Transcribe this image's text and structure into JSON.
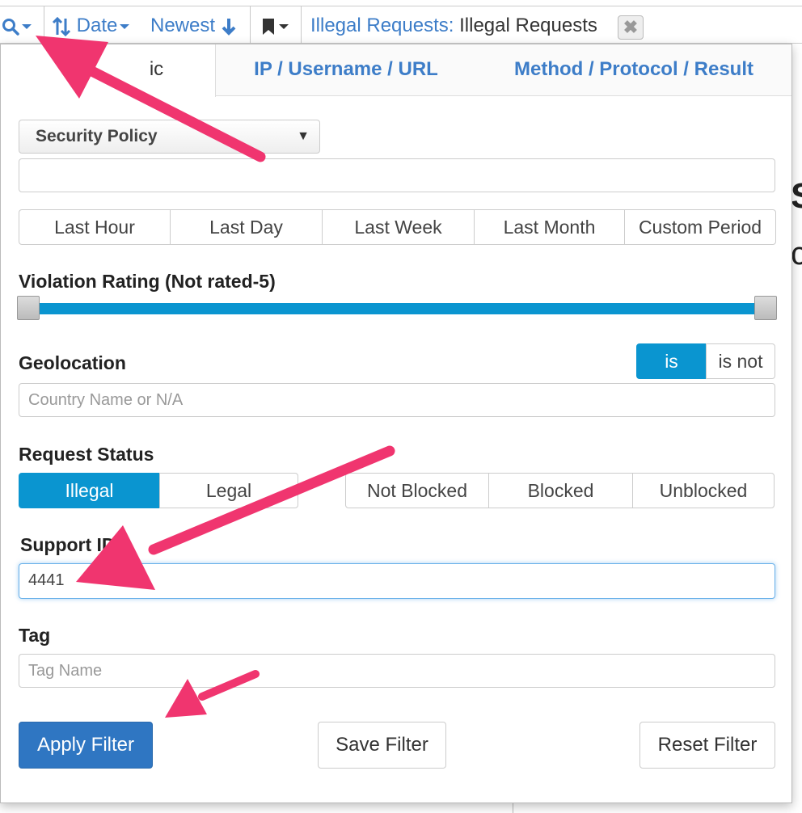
{
  "toolbar": {
    "sort_label": "Date",
    "order_label": "Newest",
    "filter_chip_key": "Illegal Requests:",
    "filter_chip_value": "Illegal Requests",
    "chip_close": "✖"
  },
  "tabs": [
    {
      "label": "ic"
    },
    {
      "label": "IP / Username / URL"
    },
    {
      "label": "Method / Protocol / Result"
    }
  ],
  "security_policy": {
    "selected": "Security Policy",
    "value": ""
  },
  "time_buttons": [
    "Last Hour",
    "Last Day",
    "Last Week",
    "Last Month",
    "Custom Period"
  ],
  "violation": {
    "label": "Violation Rating (Not rated-5)",
    "range_min": 0,
    "range_max": 5
  },
  "geolocation": {
    "label": "Geolocation",
    "is_label": "is",
    "is_not_label": "is not",
    "placeholder": "Country Name or N/A"
  },
  "request_status": {
    "label": "Request Status",
    "type_buttons": [
      "Illegal",
      "Legal"
    ],
    "block_buttons": [
      "Not Blocked",
      "Blocked",
      "Unblocked"
    ]
  },
  "support_id": {
    "label": "Support ID",
    "value": "4441"
  },
  "tag": {
    "label": "Tag",
    "placeholder": "Tag Name"
  },
  "actions": {
    "apply": "Apply Filter",
    "save": "Save Filter",
    "reset": "Reset Filter"
  },
  "colors": {
    "link": "#3d7dc8",
    "active": "#0a95d0",
    "primary": "#2f76c2",
    "annotation_arrow": "#f0356f"
  },
  "icons": [
    "search-icon",
    "sort-icon",
    "arrow-down-icon",
    "bookmark-icon",
    "close-icon",
    "dropdown-arrow-icon"
  ]
}
